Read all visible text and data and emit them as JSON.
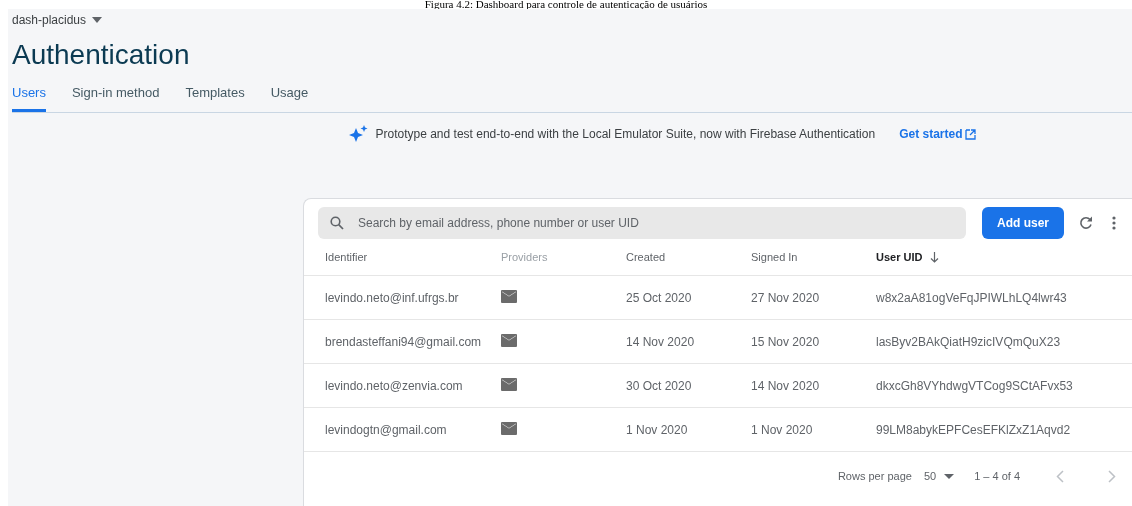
{
  "caption": "Figura 4.2: Dashboard para controle de autenticação de usuários",
  "project": "dash-placidus",
  "title": "Authentication",
  "tabs": [
    {
      "label": "Users",
      "selected": true
    },
    {
      "label": "Sign-in method",
      "selected": false
    },
    {
      "label": "Templates",
      "selected": false
    },
    {
      "label": "Usage",
      "selected": false
    }
  ],
  "banner": {
    "text": "Prototype and test end-to-end with the Local Emulator Suite, now with Firebase Authentication",
    "link": "Get started"
  },
  "search": {
    "placeholder": "Search by email address, phone number or user UID"
  },
  "add_button": "Add user",
  "table": {
    "columns": [
      {
        "label": "Identifier",
        "sorted": false
      },
      {
        "label": "Providers",
        "sorted": false
      },
      {
        "label": "Created",
        "sorted": false
      },
      {
        "label": "Signed In",
        "sorted": false
      },
      {
        "label": "User UID",
        "sorted": true
      }
    ],
    "rows": [
      {
        "identifier": "levindo.neto@inf.ufrgs.br",
        "created": "25 Oct 2020",
        "signed_in": "27 Nov 2020",
        "uid": "w8x2aA81ogVeFqJPIWLhLQ4lwr43"
      },
      {
        "identifier": "brendasteffani94@gmail.com",
        "created": "14 Nov 2020",
        "signed_in": "15 Nov 2020",
        "uid": "lasByv2BAkQiatH9zicIVQmQuX23"
      },
      {
        "identifier": "levindo.neto@zenvia.com",
        "created": "30 Oct 2020",
        "signed_in": "14 Nov 2020",
        "uid": "dkxcGh8VYhdwgVTCog9SCtAFvx53"
      },
      {
        "identifier": "levindogtn@gmail.com",
        "created": "1 Nov 2020",
        "signed_in": "1 Nov 2020",
        "uid": "99LM8abykEPFCesEFKlZxZ1Aqvd2"
      }
    ]
  },
  "pagination": {
    "rows_per_page_label": "Rows per page",
    "rows_per_page": "50",
    "range": "1 – 4 of 4"
  }
}
